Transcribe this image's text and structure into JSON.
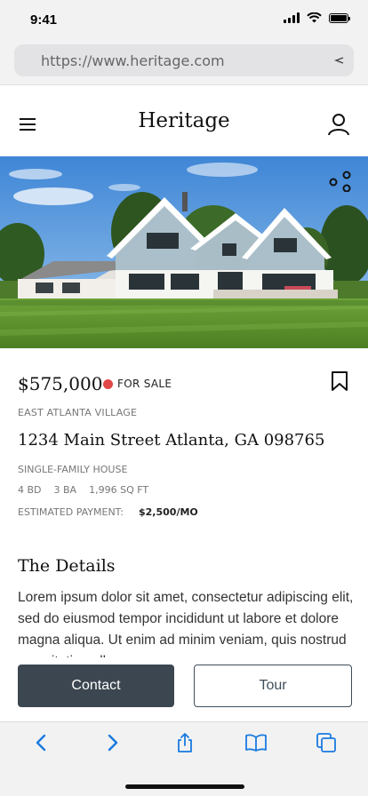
{
  "status_bar": {
    "time": "9:41"
  },
  "browser": {
    "url": "https://www.heritage.com"
  },
  "header": {
    "brand": "Heritage"
  },
  "listing": {
    "price": "$575,000",
    "status": "FOR SALE",
    "neighborhood": "EAST ATLANTA VILLAGE",
    "address": "1234 Main Street Atlanta, GA 098765",
    "home_type": "SINGLE-FAMILY HOUSE",
    "specs": {
      "beds": "4 BD",
      "baths": "3 BA",
      "sqft": "1,996 SQ FT"
    },
    "estimated_payment_label": "ESTIMATED PAYMENT:",
    "estimated_payment_value": "$2,500/MO"
  },
  "details": {
    "title": "The Details",
    "body": "Lorem ipsum dolor sit amet, consectetur adipiscing elit, sed do eiusmod tempor incididunt ut labore et dolore magna aliqua. Ut enim ad minim veniam, quis nostrud exercitation ullamco"
  },
  "actions": {
    "contact_label": "Contact",
    "tour_label": "Tour"
  },
  "icons": {
    "menu": "hamburger-icon",
    "user": "user-icon",
    "share": "share-icon",
    "bookmark": "bookmark-icon",
    "back": "chevron-left-icon",
    "forward": "chevron-right-icon",
    "share_sheet": "share-sheet-icon",
    "bookmarks": "book-icon",
    "tabs": "tabs-icon"
  },
  "colors": {
    "accent_blue": "#1a7ae0",
    "sale_red": "#e04848",
    "contact_bg": "#3b4650",
    "tour_border": "#3f4e5a"
  }
}
